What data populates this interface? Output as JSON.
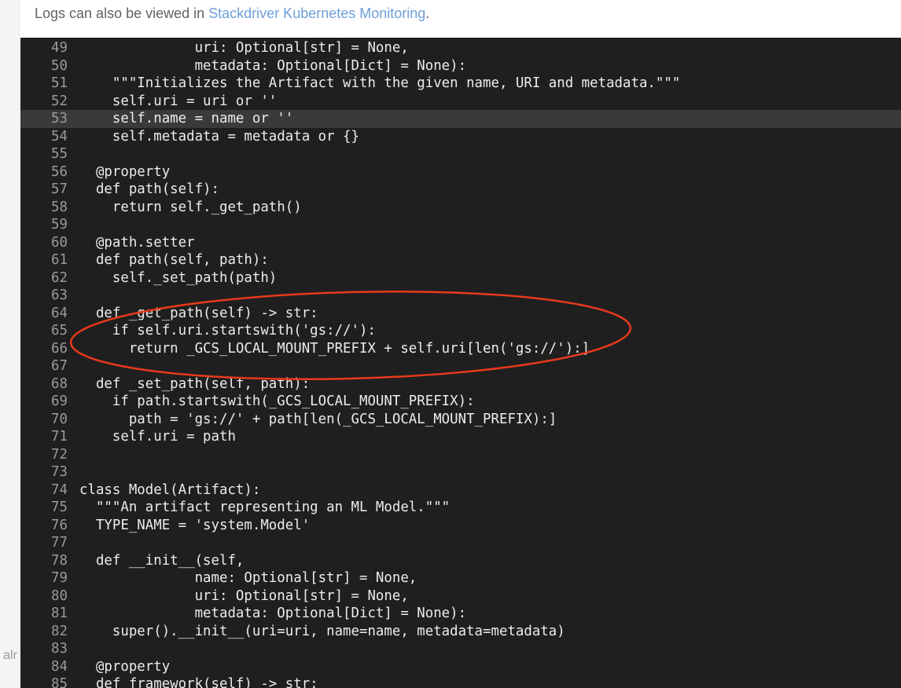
{
  "info_bar": {
    "prefix": "Logs can also be viewed in ",
    "link": "Stackdriver Kubernetes Monitoring",
    "suffix": "."
  },
  "left_rail_text": "alr",
  "code": {
    "highlighted_line": "53",
    "lines": [
      {
        "num": "49",
        "text": "              uri: Optional[str] = None,"
      },
      {
        "num": "50",
        "text": "              metadata: Optional[Dict] = None):"
      },
      {
        "num": "51",
        "text": "    \"\"\"Initializes the Artifact with the given name, URI and metadata.\"\"\""
      },
      {
        "num": "52",
        "text": "    self.uri = uri or ''"
      },
      {
        "num": "53",
        "text": "    self.name = name or ''"
      },
      {
        "num": "54",
        "text": "    self.metadata = metadata or {}"
      },
      {
        "num": "55",
        "text": ""
      },
      {
        "num": "56",
        "text": "  @property"
      },
      {
        "num": "57",
        "text": "  def path(self):"
      },
      {
        "num": "58",
        "text": "    return self._get_path()"
      },
      {
        "num": "59",
        "text": ""
      },
      {
        "num": "60",
        "text": "  @path.setter"
      },
      {
        "num": "61",
        "text": "  def path(self, path):"
      },
      {
        "num": "62",
        "text": "    self._set_path(path)"
      },
      {
        "num": "63",
        "text": ""
      },
      {
        "num": "64",
        "text": "  def _get_path(self) -> str:"
      },
      {
        "num": "65",
        "text": "    if self.uri.startswith('gs://'):"
      },
      {
        "num": "66",
        "text": "      return _GCS_LOCAL_MOUNT_PREFIX + self.uri[len('gs://'):]"
      },
      {
        "num": "67",
        "text": ""
      },
      {
        "num": "68",
        "text": "  def _set_path(self, path):"
      },
      {
        "num": "69",
        "text": "    if path.startswith(_GCS_LOCAL_MOUNT_PREFIX):"
      },
      {
        "num": "70",
        "text": "      path = 'gs://' + path[len(_GCS_LOCAL_MOUNT_PREFIX):]"
      },
      {
        "num": "71",
        "text": "    self.uri = path"
      },
      {
        "num": "72",
        "text": ""
      },
      {
        "num": "73",
        "text": ""
      },
      {
        "num": "74",
        "text": "class Model(Artifact):"
      },
      {
        "num": "75",
        "text": "  \"\"\"An artifact representing an ML Model.\"\"\""
      },
      {
        "num": "76",
        "text": "  TYPE_NAME = 'system.Model'"
      },
      {
        "num": "77",
        "text": ""
      },
      {
        "num": "78",
        "text": "  def __init__(self,"
      },
      {
        "num": "79",
        "text": "              name: Optional[str] = None,"
      },
      {
        "num": "80",
        "text": "              uri: Optional[str] = None,"
      },
      {
        "num": "81",
        "text": "              metadata: Optional[Dict] = None):"
      },
      {
        "num": "82",
        "text": "    super().__init__(uri=uri, name=name, metadata=metadata)"
      },
      {
        "num": "83",
        "text": ""
      },
      {
        "num": "84",
        "text": "  @property"
      },
      {
        "num": "85",
        "text": "  def framework(self) -> str:"
      }
    ]
  },
  "annotation": {
    "shape": "ellipse",
    "color": "#e8391c"
  },
  "colors": {
    "code_background": "#1f1f1f",
    "highlight_line": "#3a3a3a",
    "link": "#6d9fd9"
  }
}
